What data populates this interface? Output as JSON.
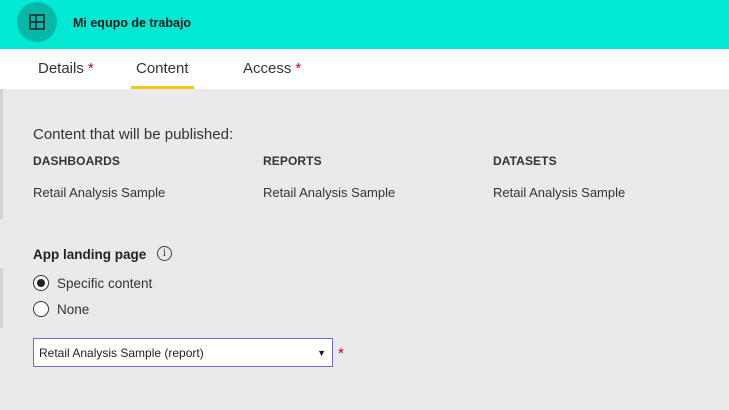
{
  "header": {
    "title": "Mi equpo de trabajo",
    "icon": "workspace-icon",
    "bg_color": "#01e8d4"
  },
  "tabs": [
    {
      "label": "Details",
      "required_mark": "*",
      "active": false
    },
    {
      "label": "Content",
      "required_mark": "",
      "active": true
    },
    {
      "label": "Access",
      "required_mark": "*",
      "active": false
    }
  ],
  "content": {
    "published_label": "Content that will be published:",
    "columns": [
      {
        "header": "DASHBOARDS",
        "value": "Retail Analysis Sample"
      },
      {
        "header": "REPORTS",
        "value": "Retail Analysis Sample"
      },
      {
        "header": "DATASETS",
        "value": "Retail Analysis Sample"
      }
    ]
  },
  "landing": {
    "label": "App landing page",
    "info_icon_glyph": "i",
    "options": [
      {
        "label": "Specific content",
        "selected": true
      },
      {
        "label": "None",
        "selected": false
      }
    ],
    "select_value": "Retail Analysis Sample (report)",
    "select_arrow": "▼",
    "required_mark": "*"
  },
  "colors": {
    "accent_tab_underline": "#f2c811",
    "required": "#d0021b",
    "select_border": "#6b6bdb"
  }
}
